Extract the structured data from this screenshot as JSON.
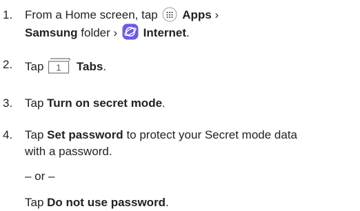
{
  "steps": [
    {
      "number": "1.",
      "text_a": "From a Home screen, tap",
      "bold_apps": "Apps",
      "chevron_1": "›",
      "bold_samsung": "Samsung",
      "text_folder": "folder",
      "chevron_2": "›",
      "bold_internet": "Internet",
      "period": "."
    },
    {
      "number": "2.",
      "text_tap": "Tap",
      "tab_count": "1",
      "bold_tabs": "Tabs",
      "period": "."
    },
    {
      "number": "3.",
      "text_tap": "Tap",
      "bold": "Turn on secret mode",
      "period": "."
    },
    {
      "number": "4.",
      "text_tap": "Tap",
      "bold": "Set password",
      "text_rest": "to protect your Secret mode data",
      "line2": "with a password.",
      "or_separator": "– or –",
      "alt_tap": "Tap",
      "alt_bold": "Do not use password",
      "alt_period": "."
    }
  ],
  "icons": {
    "apps": "apps-grid-icon",
    "internet": "samsung-internet-icon",
    "tabs": "tabs-icon"
  },
  "colors": {
    "text": "#222222",
    "internet_icon_bg": "#6b5ce0"
  }
}
